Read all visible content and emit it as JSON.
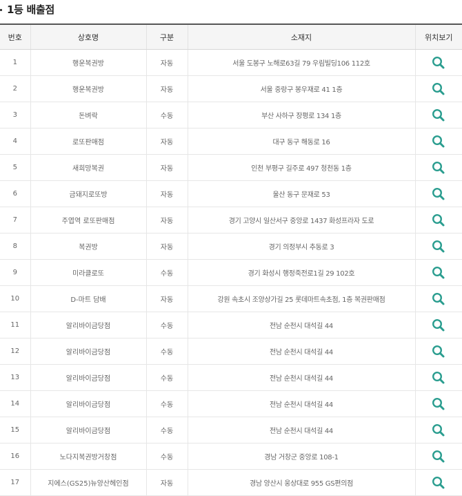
{
  "header": {
    "title": "1등 배출점"
  },
  "table": {
    "columns": [
      "번호",
      "상호명",
      "구분",
      "소재지",
      "위치보기"
    ],
    "rows": [
      {
        "no": "1",
        "name": "행운복권방",
        "type": "자동",
        "address": "서울 도봉구 노해로63길 79 우림빌딩106 112호"
      },
      {
        "no": "2",
        "name": "행운복권방",
        "type": "자동",
        "address": "서울 중랑구 봉우재로 41 1층"
      },
      {
        "no": "3",
        "name": "돈벼락",
        "type": "수동",
        "address": "부산 사하구 장평로 134 1층"
      },
      {
        "no": "4",
        "name": "로또판매점",
        "type": "자동",
        "address": "대구 동구 해동로 16"
      },
      {
        "no": "5",
        "name": "새희망복권",
        "type": "자동",
        "address": "인천 부평구 길주로 497 청천동 1층"
      },
      {
        "no": "6",
        "name": "금돼지로또방",
        "type": "자동",
        "address": "울산 동구 문재로 53"
      },
      {
        "no": "7",
        "name": "주엽역 로또판매점",
        "type": "자동",
        "address": "경기 고양시 일산서구 중앙로 1437 화성프라자 도로"
      },
      {
        "no": "8",
        "name": "복권방",
        "type": "자동",
        "address": "경기 의정부시 추동로 3"
      },
      {
        "no": "9",
        "name": "미라클로또",
        "type": "수동",
        "address": "경기 화성시 행정죽전로1길 29 102호"
      },
      {
        "no": "10",
        "name": "D-마트 담배",
        "type": "자동",
        "address": "강원 속초시 조양상가길 25 롯데마트속초점, 1층 복권판매점"
      },
      {
        "no": "11",
        "name": "알리바이금당점",
        "type": "수동",
        "address": "전남 순천시 대석길 44"
      },
      {
        "no": "12",
        "name": "알리바이금당점",
        "type": "수동",
        "address": "전남 순천시 대석길 44"
      },
      {
        "no": "13",
        "name": "알리바이금당점",
        "type": "수동",
        "address": "전남 순천시 대석길 44"
      },
      {
        "no": "14",
        "name": "알리바이금당점",
        "type": "수동",
        "address": "전남 순천시 대석길 44"
      },
      {
        "no": "15",
        "name": "알리바이금당점",
        "type": "수동",
        "address": "전남 순천시 대석길 44"
      },
      {
        "no": "16",
        "name": "노다지복권방거창점",
        "type": "수동",
        "address": "경남 거창군 중앙로 108-1"
      },
      {
        "no": "17",
        "name": "지에스(GS25)뉴양산헤인점",
        "type": "자동",
        "address": "경남 양산시 웅상대로 955 GS편의점"
      }
    ]
  },
  "icons": {
    "map_view": "search-icon"
  },
  "colors": {
    "search_icon": "#2a9d8f",
    "header_bg": "#f5f5f5",
    "top_border": "#555555"
  }
}
